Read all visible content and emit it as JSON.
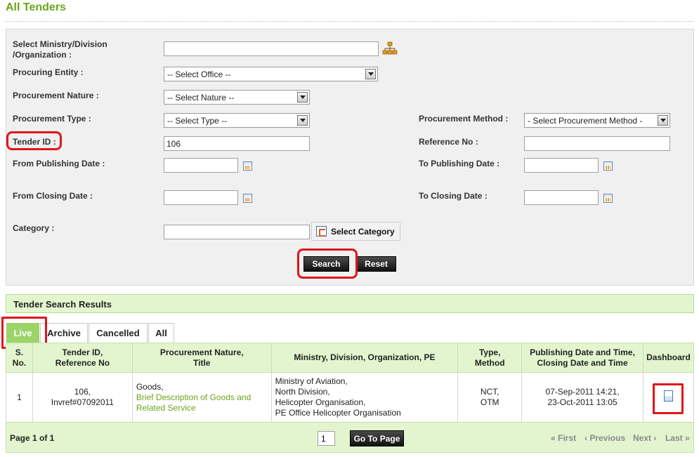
{
  "page": {
    "title": "All Tenders"
  },
  "form": {
    "ministry_label_1": "Select Ministry/Division",
    "ministry_label_2": "/Organization :",
    "ministry_value": "",
    "procuring_entity_label": "Procuring Entity :",
    "procuring_entity_value": "-- Select Office --",
    "nature_label": "Procurement Nature :",
    "nature_value": "-- Select Nature --",
    "type_label": "Procurement Type :",
    "type_value": "-- Select Type --",
    "method_label": "Procurement Method :",
    "method_value": "- Select Procurement Method -",
    "tender_id_label": "Tender ID :",
    "tender_id_value": "106",
    "reference_label": "Reference No :",
    "reference_value": "",
    "from_pub_label": "From Publishing Date :",
    "to_pub_label": "To Publishing Date :",
    "from_close_label": "From Closing Date :",
    "to_close_label": "To Closing Date :",
    "category_label": "Category :",
    "category_value": "",
    "select_category_label": "Select Category",
    "search_label": "Search",
    "reset_label": "Reset"
  },
  "results": {
    "title": "Tender Search Results",
    "tabs": [
      {
        "label": "Live"
      },
      {
        "label": "Archive"
      },
      {
        "label": "Cancelled"
      },
      {
        "label": "All"
      }
    ],
    "columns": {
      "sno_1": "S.",
      "sno_2": "No.",
      "tender_1": "Tender ID,",
      "tender_2": "Reference No",
      "nature_1": "Procurement Nature,",
      "nature_2": "Title",
      "ministry": "Ministry, Division, Organization, PE",
      "type_1": "Type,",
      "type_2": "Method",
      "dates_1": "Publishing Date and Time,",
      "dates_2": "Closing Date and Time",
      "dashboard": "Dashboard"
    },
    "rows": [
      {
        "sno": "1",
        "tender_id": "106,",
        "reference": "Invref#07092011",
        "nature": "Goods,",
        "title_1": "Brief Description of Goods and",
        "title_2": "Related Service",
        "ministry_1": "Ministry of Aviation,",
        "ministry_2": "North Division,",
        "ministry_3": "Helicopter Organisation,",
        "ministry_4": "PE Office Helicopter Organisation",
        "type": "NCT,",
        "method": "OTM",
        "publishing": "07-Sep-2011 14:21,",
        "closing": "23-Oct-2011 13:05"
      }
    ]
  },
  "pagination": {
    "page_label": "Page 1 of 1",
    "page_input": "1",
    "go_label": "Go To Page",
    "first": "« First",
    "previous": "‹ Previous",
    "next": "Next ›",
    "last": "Last »"
  },
  "colors": {
    "accent_green": "#6aa51c",
    "highlight_red": "#e0151b",
    "results_bg": "#e3f5cf"
  }
}
